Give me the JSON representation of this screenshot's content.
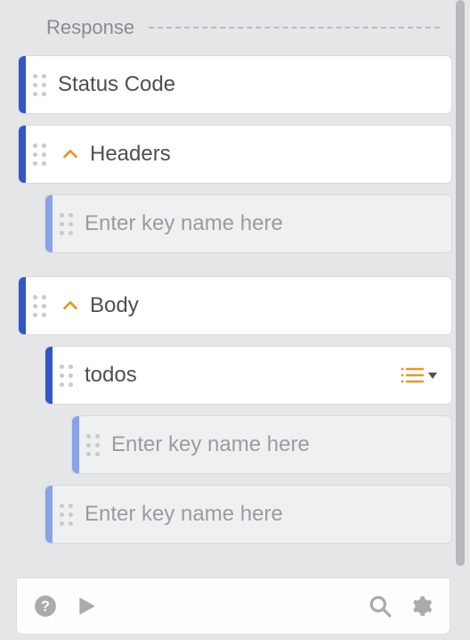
{
  "section": {
    "title": "Response"
  },
  "items": {
    "status_code": {
      "label": "Status Code"
    },
    "headers": {
      "label": "Headers",
      "placeholder": "Enter key name here"
    },
    "body": {
      "label": "Body",
      "todos": {
        "label": "todos",
        "child_placeholder": "Enter key name here"
      },
      "placeholder": "Enter key name here"
    }
  },
  "colors": {
    "accent_dark": "#2f57c9",
    "accent_light": "#8aa3e6",
    "toggle": "#e09a2b"
  }
}
